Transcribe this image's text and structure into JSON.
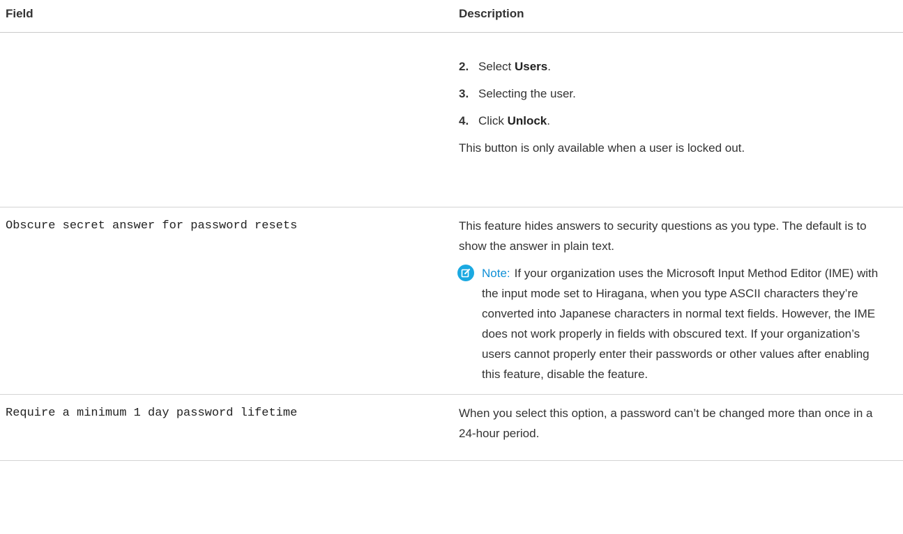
{
  "header": {
    "field": "Field",
    "description": "Description"
  },
  "rows": [
    {
      "field": "",
      "steps": [
        {
          "num": "2.",
          "prefix": "Select ",
          "bold": "Users",
          "suffix": "."
        },
        {
          "num": "3.",
          "prefix": "Selecting the user.",
          "bold": "",
          "suffix": ""
        },
        {
          "num": "4.",
          "prefix": "Click ",
          "bold": "Unlock",
          "suffix": "."
        }
      ],
      "step_note": "This button is only available when a user is locked out."
    },
    {
      "field": "Obscure secret answer for password resets",
      "description": "This feature hides answers to security questions as you type. The default is to show the answer in plain text.",
      "note_label": "Note:",
      "note_text": "If your organization uses the Microsoft Input Method Editor (IME) with the input mode set to Hiragana, when you type ASCII characters they’re converted into Japanese characters in normal text fields. However, the IME does not work properly in fields with obscured text. If your organization’s users cannot properly enter their passwords or other values after enabling this feature, disable the feature.",
      "note_icon": "note-edit-icon"
    },
    {
      "field": "Require a minimum 1 day password lifetime",
      "description": "When you select this option, a password can’t be changed more than once in a 24-hour period."
    }
  ],
  "colors": {
    "note_icon_bg": "#1ba9e1",
    "note_label": "#0f8fd6",
    "text": "#333333"
  }
}
